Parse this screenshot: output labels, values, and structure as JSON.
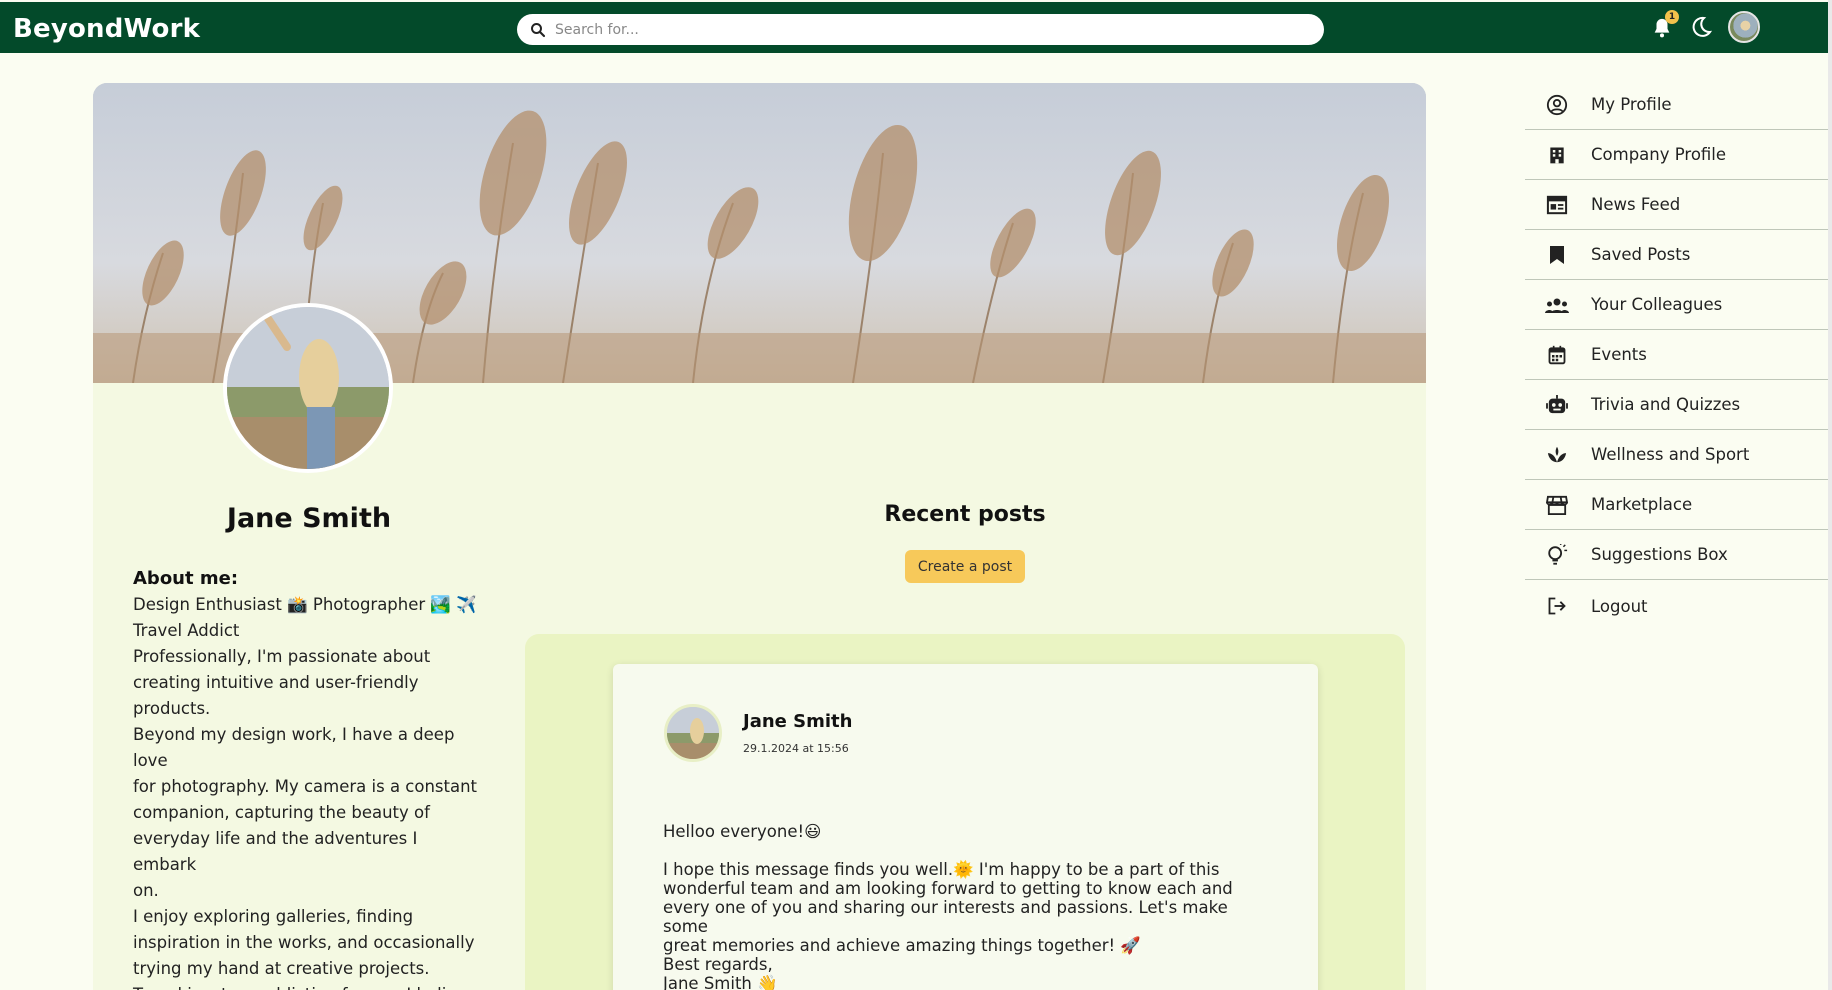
{
  "header": {
    "brand": "BeyondWork",
    "search_placeholder": "Search for...",
    "notification_count": "1"
  },
  "profile": {
    "name": "Jane Smith",
    "about_title": "About me:",
    "about_text": "Design Enthusiast 📸 Photographer 🏞️ ✈️\nTravel Addict\nProfessionally, I'm passionate about\ncreating intuitive and user-friendly\nproducts.\nBeyond my design work, I have a deep love\nfor photography. My camera is a constant\ncompanion, capturing the beauty of\neveryday life and the adventures I embark\non.\nI enjoy exploring galleries, finding\ninspiration in the works, and occasionally\ntrying my hand at creative projects.\nTravel is a true addiction for me. I believe\nthat experiencing different cultures and"
  },
  "posts": {
    "title": "Recent posts",
    "create_label": "Create a post",
    "items": [
      {
        "author": "Jane Smith",
        "time": "29.1.2024 at 15:56",
        "body": "Helloo everyone!😃\n\nI hope this message finds you well.🌞 I'm happy to be a part of this\nwonderful team and am looking forward to getting to know each and\nevery one of you and sharing our interests and passions. Let's make some\ngreat memories and achieve amazing things together! 🚀\nBest regards,\nJane Smith 👋"
      }
    ]
  },
  "sidebar": {
    "items": [
      {
        "label": "My Profile",
        "icon": "user-circle-icon"
      },
      {
        "label": "Company Profile",
        "icon": "building-icon"
      },
      {
        "label": "News Feed",
        "icon": "newspaper-icon"
      },
      {
        "label": "Saved Posts",
        "icon": "bookmark-icon"
      },
      {
        "label": "Your Colleagues",
        "icon": "people-icon"
      },
      {
        "label": "Events",
        "icon": "calendar-icon"
      },
      {
        "label": "Trivia and Quizzes",
        "icon": "robot-icon"
      },
      {
        "label": "Wellness and Sport",
        "icon": "lotus-icon"
      },
      {
        "label": "Marketplace",
        "icon": "store-icon"
      },
      {
        "label": "Suggestions Box",
        "icon": "lightbulb-icon"
      },
      {
        "label": "Logout",
        "icon": "logout-icon"
      }
    ]
  },
  "colors": {
    "topbar": "#034a2a",
    "page_bg": "#fbfdf2",
    "card_bg": "#f4f9e2",
    "posts_panel": "#eaf4c3",
    "accent_button": "#f7c95a",
    "badge": "#f2c14c"
  }
}
